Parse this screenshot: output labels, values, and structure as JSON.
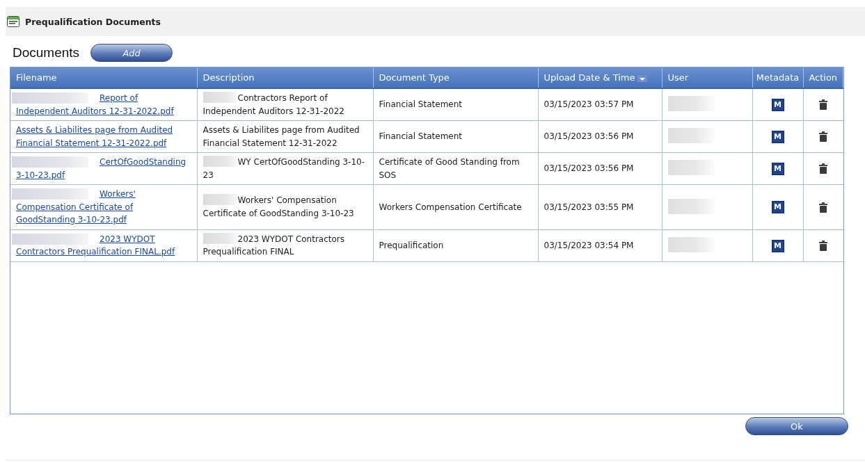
{
  "window": {
    "title": "Prequalification Documents"
  },
  "section": {
    "title": "Documents",
    "add_button": "Add"
  },
  "table": {
    "columns": [
      {
        "label": "Filename",
        "sorted": false
      },
      {
        "label": "Description",
        "sorted": false
      },
      {
        "label": "Document Type",
        "sorted": false
      },
      {
        "label": "Upload Date & Time",
        "sorted": true
      },
      {
        "label": "User",
        "sorted": false
      },
      {
        "label": "Metadata",
        "sorted": false
      },
      {
        "label": "Action",
        "sorted": false
      }
    ],
    "rows": [
      {
        "filename": "Report of Independent Auditors 12-31-2022.pdf",
        "filename_redacted": true,
        "description": "Contractors Report of Independent Auditors 12-31-2022",
        "description_redacted": true,
        "document_type": "Financial Statement",
        "uploaded": "03/15/2023 03:57 PM",
        "user_redacted": true,
        "metadata": "M"
      },
      {
        "filename": "Assets & Liabilites page from Audited Financial Statement 12-31-2022.pdf",
        "filename_redacted": false,
        "description": "Assets & Liabilites page from Audited Financial Statement 12-31-2022",
        "description_redacted": false,
        "document_type": "Financial Statement",
        "uploaded": "03/15/2023 03:56 PM",
        "user_redacted": true,
        "metadata": "M"
      },
      {
        "filename": "CertOfGoodStanding 3-10-23.pdf",
        "filename_redacted": true,
        "description": "WY CertOfGoodStanding 3-10-23",
        "description_redacted": true,
        "document_type": "Certificate of Good Standing from SOS",
        "uploaded": "03/15/2023 03:56 PM",
        "user_redacted": true,
        "metadata": "M"
      },
      {
        "filename": "Workers' Compensation Certificate of GoodStanding 3-10-23.pdf",
        "filename_redacted": true,
        "description": "Workers' Compensation Certificate of GoodStanding 3-10-23",
        "description_redacted": true,
        "document_type": "Workers Compensation Certificate",
        "uploaded": "03/15/2023 03:55 PM",
        "user_redacted": true,
        "metadata": "M"
      },
      {
        "filename": "2023 WYDOT Contractors Prequalification FINAL.pdf",
        "filename_redacted": true,
        "description": "2023 WYDOT Contractors Prequalification FINAL",
        "description_redacted": true,
        "document_type": "Prequalification",
        "uploaded": "03/15/2023 03:54 PM",
        "user_redacted": true,
        "metadata": "M"
      }
    ]
  },
  "ok_button": "Ok"
}
